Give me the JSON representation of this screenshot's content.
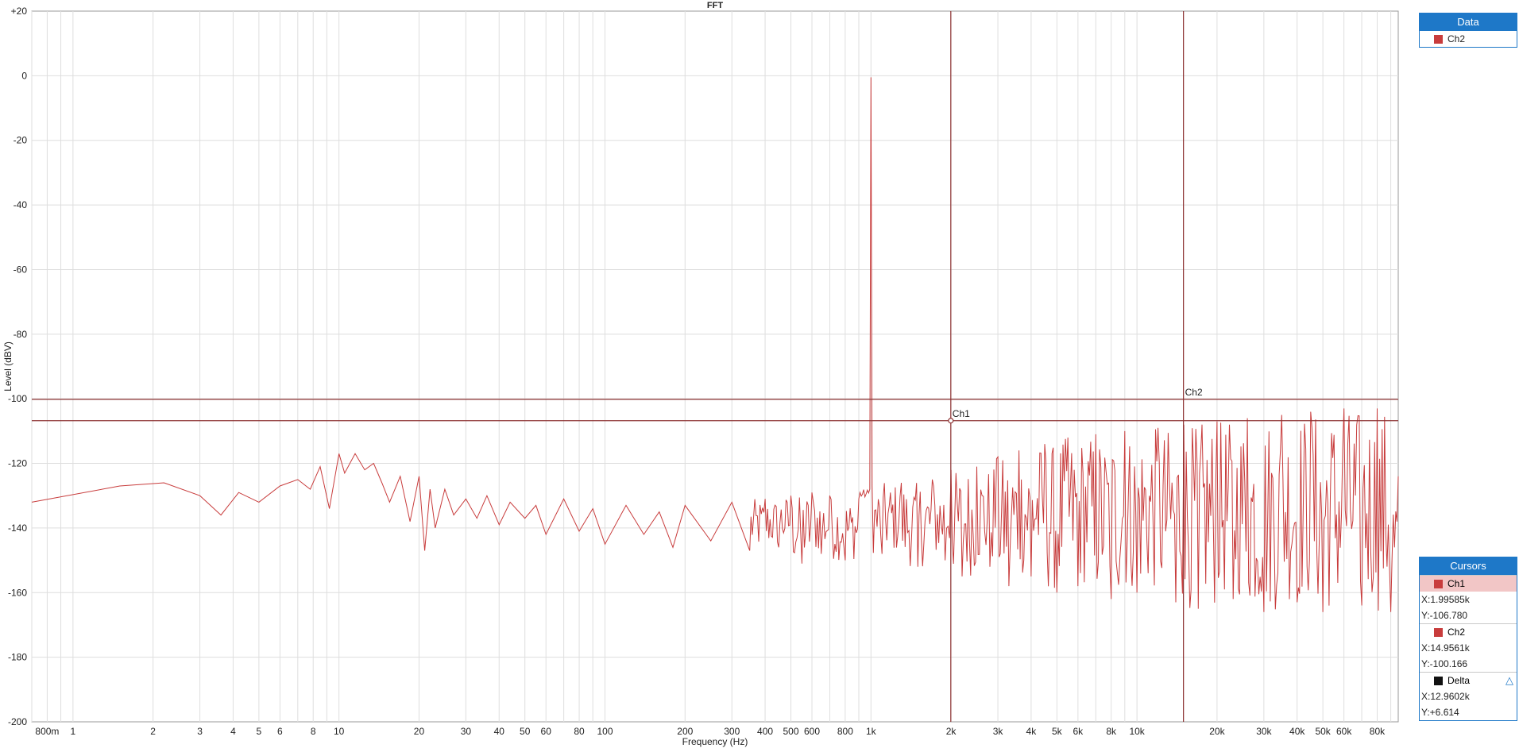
{
  "chart_data": {
    "type": "line",
    "title": "FFT",
    "xlabel": "Frequency (Hz)",
    "ylabel": "Level (dBV)",
    "x_scale": "log",
    "xlim": [
      0.7,
      96000
    ],
    "ylim": [
      -200,
      20
    ],
    "grid": true,
    "y_ticks": [
      20,
      0,
      -20,
      -40,
      -60,
      -80,
      -100,
      -120,
      -140,
      -160,
      -180,
      -200
    ],
    "y_tick_labels": [
      "+20",
      "0",
      "-20",
      "-40",
      "-60",
      "-80",
      "-100",
      "-120",
      "-140",
      "-160",
      "-180",
      "-200"
    ],
    "x_ticks": [
      {
        "v": 0.8,
        "label": "800m"
      },
      {
        "v": 1,
        "label": "1"
      },
      {
        "v": 2,
        "label": "2"
      },
      {
        "v": 3,
        "label": "3"
      },
      {
        "v": 4,
        "label": "4"
      },
      {
        "v": 5,
        "label": "5"
      },
      {
        "v": 6,
        "label": "6"
      },
      {
        "v": 8,
        "label": "8"
      },
      {
        "v": 10,
        "label": "10"
      },
      {
        "v": 20,
        "label": "20"
      },
      {
        "v": 30,
        "label": "30"
      },
      {
        "v": 40,
        "label": "40"
      },
      {
        "v": 50,
        "label": "50"
      },
      {
        "v": 60,
        "label": "60"
      },
      {
        "v": 80,
        "label": "80"
      },
      {
        "v": 100,
        "label": "100"
      },
      {
        "v": 200,
        "label": "200"
      },
      {
        "v": 300,
        "label": "300"
      },
      {
        "v": 400,
        "label": "400"
      },
      {
        "v": 500,
        "label": "500"
      },
      {
        "v": 600,
        "label": "600"
      },
      {
        "v": 800,
        "label": "800"
      },
      {
        "v": 1000,
        "label": "1k"
      },
      {
        "v": 2000,
        "label": "2k"
      },
      {
        "v": 3000,
        "label": "3k"
      },
      {
        "v": 4000,
        "label": "4k"
      },
      {
        "v": 5000,
        "label": "5k"
      },
      {
        "v": 6000,
        "label": "6k"
      },
      {
        "v": 8000,
        "label": "8k"
      },
      {
        "v": 10000,
        "label": "10k"
      },
      {
        "v": 20000,
        "label": "20k"
      },
      {
        "v": 30000,
        "label": "30k"
      },
      {
        "v": 40000,
        "label": "40k"
      },
      {
        "v": 50000,
        "label": "50k"
      },
      {
        "v": 60000,
        "label": "60k"
      },
      {
        "v": 80000,
        "label": "80k"
      }
    ],
    "series": [
      {
        "name": "Ch2",
        "color": "#c83c3c",
        "x": [
          0.7,
          1.5,
          2.2,
          3,
          3.6,
          4.2,
          5,
          6,
          7,
          7.8,
          8.5,
          9.2,
          10,
          10.5,
          11.5,
          12.5,
          13.5,
          14.5,
          15.5,
          17,
          18.5,
          20,
          21,
          22,
          23,
          25,
          27,
          30,
          33,
          36,
          40,
          44,
          50,
          55,
          60,
          70,
          80,
          90,
          100,
          120,
          140,
          160,
          180,
          200,
          250,
          300,
          350,
          400,
          450,
          500,
          550,
          600,
          650,
          700,
          800,
          900,
          990,
          1000,
          1010,
          1100,
          1300,
          1500,
          1700,
          1900,
          2000,
          2200,
          2500,
          2800,
          3000,
          3300,
          3600,
          4000,
          4500,
          5000,
          5500,
          6000,
          7000,
          8000,
          9000,
          10000,
          12000,
          14000,
          15000,
          17000,
          20000,
          23000,
          26000,
          30000,
          35000,
          40000,
          45000,
          50000,
          60000,
          70000,
          80000,
          90000,
          96000
        ],
        "y": [
          -132,
          -127,
          -126,
          -130,
          -136,
          -129,
          -132,
          -127,
          -125,
          -128,
          -121,
          -134,
          -117,
          -123,
          -117,
          -122,
          -120,
          -126,
          -132,
          -124,
          -138,
          -124,
          -147,
          -128,
          -140,
          -128,
          -136,
          -131,
          -137,
          -130,
          -139,
          -132,
          -137,
          -133,
          -142,
          -131,
          -141,
          -134,
          -145,
          -133,
          -142,
          -135,
          -146,
          -133,
          -144,
          -132,
          -147,
          -131,
          -146,
          -130,
          -151,
          -129,
          -148,
          -130,
          -150,
          -131,
          -128,
          -0.5,
          -127,
          -148,
          -126,
          -152,
          -125,
          -150,
          -122,
          -155,
          -121,
          -152,
          -118,
          -158,
          -116,
          -155,
          -114,
          -160,
          -112,
          -158,
          -111,
          -162,
          -110,
          -160,
          -109,
          -163,
          -108,
          -165,
          -107,
          -162,
          -106,
          -166,
          -105,
          -163,
          -104,
          -166,
          -103,
          -164,
          -103,
          -166,
          -124
        ]
      }
    ],
    "cursor_lines_y": [
      -100.166,
      -106.78
    ]
  },
  "legend": {
    "title": "Data",
    "items": [
      {
        "name": "Ch2",
        "color": "#c83c3c"
      }
    ]
  },
  "cursors": {
    "title": "Cursors",
    "items": [
      {
        "name": "Ch1",
        "color": "#c83c3c",
        "x": 1995.85,
        "y": -106.78,
        "x_text": "X:1.99585k",
        "y_text": "Y:-106.780"
      },
      {
        "name": "Ch2",
        "color": "#c83c3c",
        "x": 14956.1,
        "y": -100.166,
        "x_text": "X:14.9561k",
        "y_text": "Y:-100.166"
      },
      {
        "name": "Delta",
        "color": "#111111",
        "x_text": "X:12.9602k",
        "y_text": "Y:+6.614"
      }
    ]
  }
}
